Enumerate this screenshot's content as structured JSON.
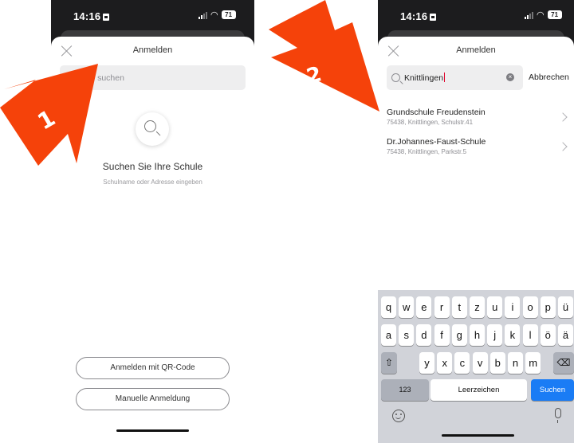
{
  "screen1": {
    "status": {
      "time": "14:16",
      "battery": "71"
    },
    "sheet": {
      "title": "Anmelden",
      "search_placeholder": "Schule suchen",
      "search_visible_text": "le suchen",
      "empty_title": "Suchen Sie Ihre Schule",
      "empty_subtitle": "Schulname oder Adresse eingeben"
    },
    "buttons": {
      "qr": "Anmelden mit QR-Code",
      "manual": "Manuelle Anmeldung"
    }
  },
  "screen2": {
    "status": {
      "time": "14:16",
      "battery": "71"
    },
    "sheet": {
      "title": "Anmelden",
      "search_value": "Knittlingen",
      "clear_glyph": "×",
      "cancel": "Abbrechen"
    },
    "results": [
      {
        "name": "Grundschule Freudenstein",
        "address": "75438, Knittlingen, Schulstr.41"
      },
      {
        "name": "Dr.Johannes-Faust-Schule",
        "address": "75438, Knittlingen, Parkstr.5"
      }
    ],
    "keyboard": {
      "row1": [
        "q",
        "w",
        "e",
        "r",
        "t",
        "z",
        "u",
        "i",
        "o",
        "p",
        "ü"
      ],
      "row2": [
        "a",
        "s",
        "d",
        "f",
        "g",
        "h",
        "j",
        "k",
        "l",
        "ö",
        "ä"
      ],
      "row3": [
        "y",
        "x",
        "c",
        "v",
        "b",
        "n",
        "m"
      ],
      "shift_glyph": "⇧",
      "delete_glyph": "⌫",
      "numbers_label": "123",
      "space_label": "Leerzeichen",
      "action_label": "Suchen"
    }
  },
  "annotations": {
    "step1": "1",
    "step2": "2",
    "arrow_color": "#f5420a"
  }
}
